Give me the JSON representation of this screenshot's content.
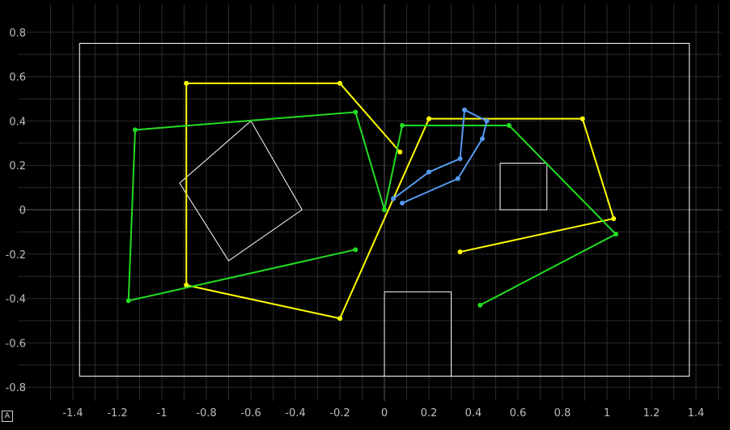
{
  "autoscale_button": {
    "label": "A"
  },
  "chart_data": {
    "type": "line",
    "title": "",
    "xlabel": "",
    "ylabel": "",
    "xlim": [
      -1.57,
      1.52
    ],
    "ylim": [
      -0.86,
      0.87
    ],
    "x_ticks": [
      -1.4,
      -1.2,
      -1,
      -0.8,
      -0.6,
      -0.4,
      -0.2,
      0,
      0.2,
      0.4,
      0.6,
      0.8,
      1,
      1.2,
      1.4
    ],
    "x_tick_labels": [
      "-1.4",
      "-1.2",
      "-1",
      "-0.8",
      "-0.6",
      "-0.4",
      "-0.2",
      "0",
      "0.2",
      "0.4",
      "0.6",
      "0.8",
      "1",
      "1.2",
      "1.4"
    ],
    "y_ticks": [
      -0.8,
      -0.6,
      -0.4,
      -0.2,
      0,
      0.2,
      0.4,
      0.6,
      0.8
    ],
    "y_tick_labels": [
      "-0.8",
      "-0.6",
      "-0.4",
      "-0.2",
      "0",
      "0.2",
      "0.4",
      "0.6",
      "0.8"
    ],
    "grid": true,
    "colors": {
      "background": "#000000",
      "grid": "#2a2a2a",
      "zero_axis": "#5a5a5a",
      "tick_text": "#bdbdbd",
      "outline": "#ffffff"
    },
    "series": [
      {
        "color": "#ffff00",
        "markers": true,
        "x": [
          0.07,
          -0.2,
          -0.89,
          -0.89,
          -0.2,
          0.2,
          0.89,
          1.03,
          0.34
        ],
        "y": [
          0.26,
          0.57,
          0.57,
          -0.34,
          -0.49,
          0.41,
          0.41,
          -0.04,
          -0.19
        ]
      },
      {
        "color": "#22dd22",
        "markers": true,
        "x": [
          0.43,
          1.04,
          0.56,
          0.08,
          0.0,
          -0.13,
          -1.12,
          -1.15,
          -0.13
        ],
        "y": [
          -0.43,
          -0.11,
          0.38,
          0.38,
          0.0,
          0.44,
          0.36,
          -0.41,
          -0.18
        ]
      },
      {
        "color": "#5599ee",
        "markers": true,
        "x": [
          0.08,
          0.33,
          0.44,
          0.46,
          0.36,
          0.34,
          0.2,
          0.04
        ],
        "y": [
          0.03,
          0.14,
          0.32,
          0.4,
          0.45,
          0.23,
          0.17,
          0.05
        ]
      }
    ],
    "shapes": [
      {
        "color": "#ffffff",
        "x": [
          -1.37,
          1.37,
          1.37,
          -1.37,
          -1.37
        ],
        "y": [
          0.75,
          0.75,
          -0.75,
          -0.75,
          0.75
        ]
      },
      {
        "color": "#ffffff",
        "x": [
          -0.6,
          -0.37,
          -0.7,
          -0.92,
          -0.6
        ],
        "y": [
          0.4,
          0.0,
          -0.23,
          0.12,
          0.4
        ]
      },
      {
        "color": "#ffffff",
        "x": [
          0.52,
          0.73,
          0.73,
          0.52,
          0.52
        ],
        "y": [
          0.21,
          0.21,
          0.0,
          0.0,
          0.21
        ]
      },
      {
        "color": "#ffffff",
        "x": [
          0.0,
          0.3,
          0.3,
          0.0,
          0.0
        ],
        "y": [
          -0.37,
          -0.37,
          -0.75,
          -0.75,
          -0.37
        ]
      }
    ]
  }
}
